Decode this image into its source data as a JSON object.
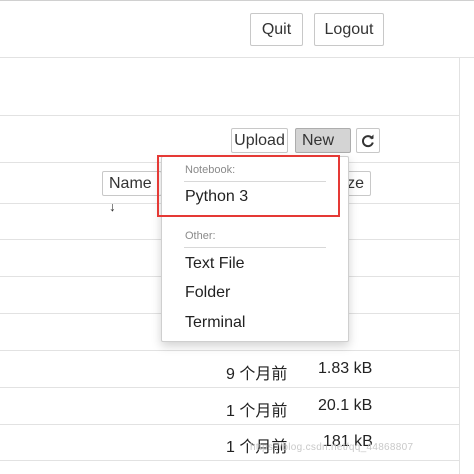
{
  "header": {
    "quit_label": "Quit",
    "logout_label": "Logout"
  },
  "toolbar": {
    "upload_label": "Upload",
    "new_label": "New",
    "refresh_icon": "refresh-icon"
  },
  "columns": {
    "name_label": "Name",
    "size_label_partial": "ze"
  },
  "dropdown": {
    "notebook_header": "Notebook:",
    "python3": "Python 3",
    "other_header": "Other:",
    "text_file": "Text File",
    "folder": "Folder",
    "terminal": "Terminal"
  },
  "rows": [
    {
      "modified": "9 个月前",
      "size": "1.83 kB"
    },
    {
      "modified": "1 个月前",
      "size": "20.1 kB"
    },
    {
      "modified": "1 个月前",
      "size": "181 kB"
    }
  ],
  "watermark": "https://blog.csdn.net/qq_44868807",
  "colors": {
    "highlight": "#e53935",
    "new_button_bg": "#d4d4d4"
  }
}
